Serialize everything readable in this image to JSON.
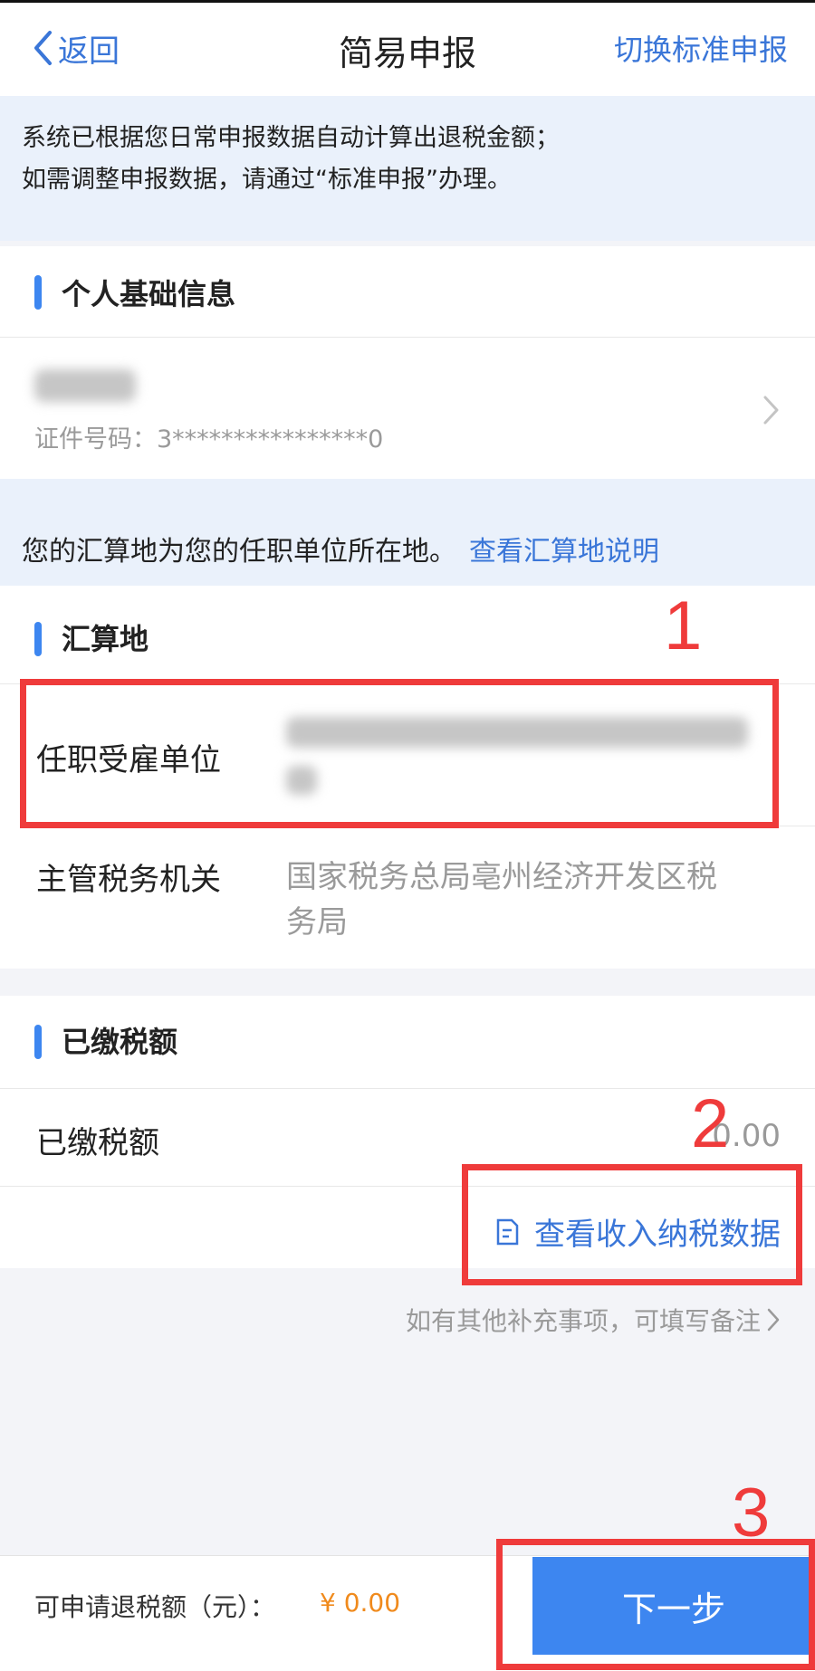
{
  "nav": {
    "back_label": "返回",
    "title": "简易申报",
    "switch_label": "切换标准申报"
  },
  "notice": {
    "line1": "系统已根据您日常申报数据自动计算出退税金额；",
    "line2": "如需调整申报数据，请通过“标准申报”办理。"
  },
  "personal": {
    "section_title": "个人基础信息",
    "id_label": "证件号码：",
    "id_value": "3****************0"
  },
  "region_notice": {
    "text": "您的汇算地为您的任职单位所在地。",
    "link": "查看汇算地说明"
  },
  "settlement": {
    "section_title": "汇算地",
    "employer_label": "任职受雇单位",
    "tax_office_label": "主管税务机关",
    "tax_office_value": "国家税务总局亳州经济开发区税务局",
    "tax_office_line1": "国家税务总局亳州经济开发区税",
    "tax_office_line2": "务局"
  },
  "paid": {
    "section_title": "已缴税额",
    "label": "已缴税额",
    "value": "0.00",
    "view_data": "查看收入纳税数据"
  },
  "remark": {
    "text": "如有其他补充事项，可填写备注"
  },
  "footer": {
    "refund_label": "可申请退税额（元）：",
    "refund_value": "¥ 0.00",
    "next_label": "下一步"
  },
  "annotations": {
    "n1": "1",
    "n2": "2",
    "n3": "3",
    "color": "#ef3b3b"
  },
  "colors": {
    "accent": "#3d86f0",
    "link": "#3a76d8",
    "refund": "#f08a1c"
  }
}
